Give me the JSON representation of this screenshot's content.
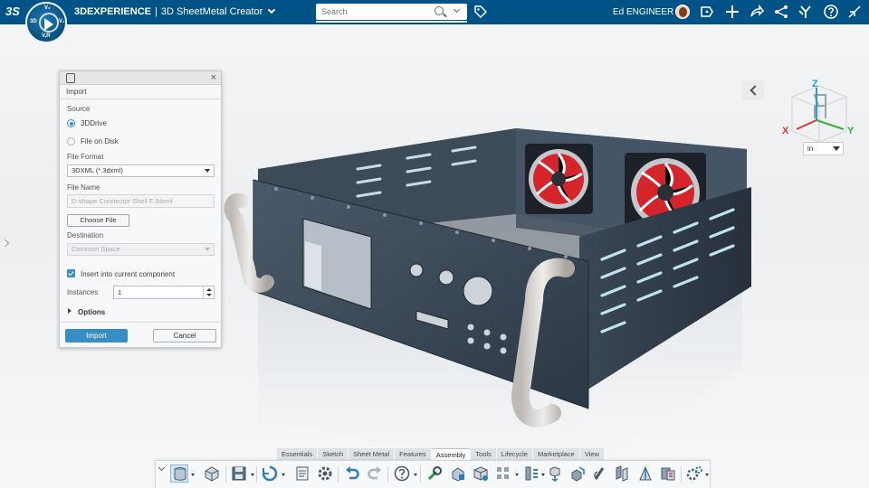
{
  "app": {
    "brand_prefix": "3DEXPERIENCE",
    "brand_sep": "|",
    "app_name": "3D SheetMetal Creator",
    "logo_text": "3S",
    "compass_letters": [
      "V₂",
      "3D",
      "V₁",
      "V,R"
    ]
  },
  "search": {
    "placeholder": "Search"
  },
  "user": {
    "name": "Ed ENGINEER"
  },
  "topbar_icons": [
    "tag-icon",
    "notifications-icon",
    "add-icon",
    "share-icon",
    "network-icon",
    "apps-icon",
    "help-icon",
    "collapse-icon"
  ],
  "viewport": {
    "units": "in",
    "axes": {
      "x": "X",
      "y": "Y",
      "z": "Z"
    }
  },
  "import_dialog": {
    "title": "Import",
    "source_label": "Source",
    "source_options": [
      "3DDrive",
      "File on Disk"
    ],
    "source_selected": "3DDrive",
    "file_format_label": "File Format",
    "file_format_value": "3DXML (*.3dxml)",
    "file_name_label": "File Name",
    "file_name_value": "D-shape Connector Shell F.3dxml",
    "choose_file_label": "Choose File",
    "destination_label": "Destination",
    "destination_value": "Common Space",
    "insert_label": "Insert into current component",
    "insert_checked": true,
    "instances_label": "Instances",
    "instances_value": "1",
    "options_label": "Options",
    "import_button": "Import",
    "cancel_button": "Cancel"
  },
  "action_bar": {
    "tabs": [
      "Essentials",
      "Sketch",
      "Sheet Metal",
      "Features",
      "Assembly",
      "Tools",
      "Lifecycle",
      "Marketplace",
      "View"
    ],
    "active_tab": "Assembly",
    "icons": [
      "import-icon",
      "insert-part-icon",
      "save-icon",
      "refresh-icon",
      "properties-icon",
      "settings-icon",
      "undo-icon",
      "redo-icon",
      "help-icon",
      "mate-icon",
      "fix-icon",
      "assembly-icon",
      "pattern-icon",
      "explode-icon",
      "move-icon",
      "replace-icon",
      "flexible-icon",
      "connect-icon",
      "measure-icon",
      "section-icon",
      "compare-icon",
      "configure-icon"
    ]
  },
  "colors": {
    "topbar": "#005386",
    "accent": "#368ec4",
    "chassis": "#3c4a59",
    "fan_blade": "#d6252a"
  }
}
